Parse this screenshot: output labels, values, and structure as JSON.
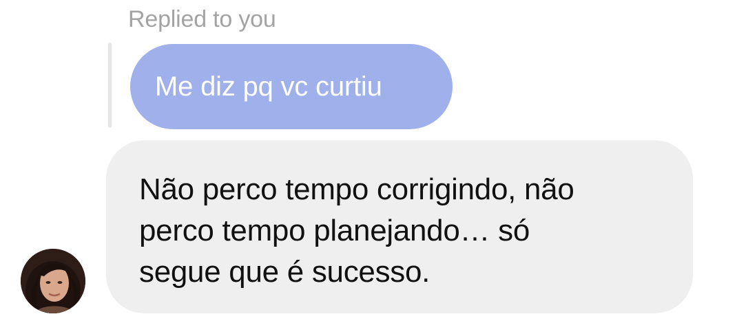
{
  "thread": {
    "reply_label": "Replied to you",
    "quoted_message": "Me diz pq vc curtiu",
    "message_lines": [
      "Não perco tempo corrigindo, não",
      "perco tempo planejando… só",
      "segue que é sucesso."
    ]
  },
  "avatar": {
    "icon": "profile-photo"
  },
  "colors": {
    "quoted_bubble": "#9fb0ea",
    "message_bubble": "#efefef",
    "label": "#a3a3a3"
  }
}
